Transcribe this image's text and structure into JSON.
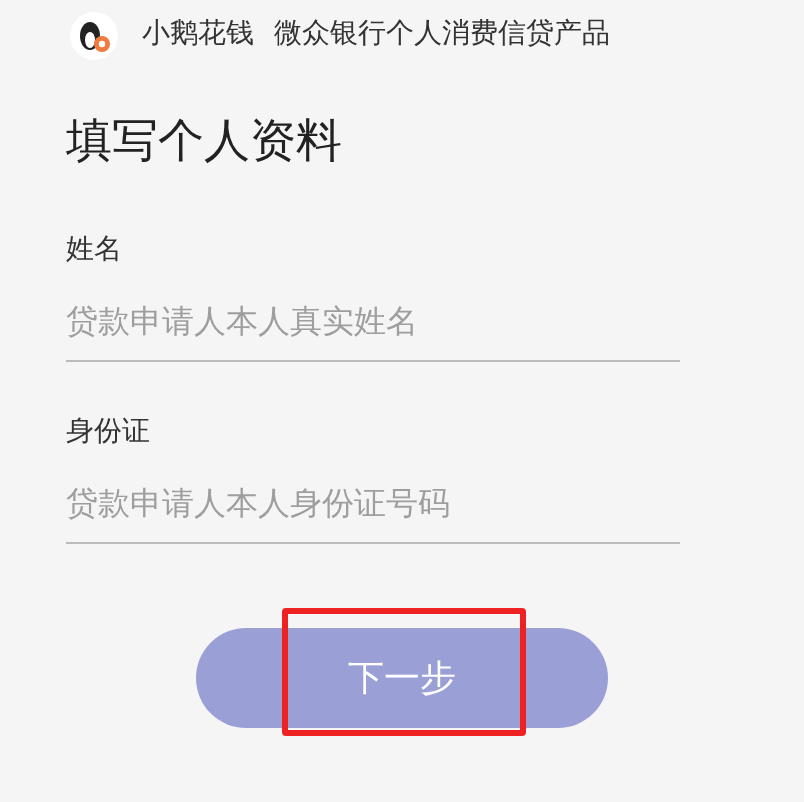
{
  "header": {
    "brand": "小鹅花钱",
    "tagline": "微众银行个人消费信贷产品"
  },
  "title": "填写个人资料",
  "fields": [
    {
      "label": "姓名",
      "placeholder": "贷款申请人本人真实姓名"
    },
    {
      "label": "身份证",
      "placeholder": "贷款申请人本人身份证号码"
    }
  ],
  "next_button": {
    "label": "下一步",
    "disabled": true,
    "highlighted": true
  }
}
